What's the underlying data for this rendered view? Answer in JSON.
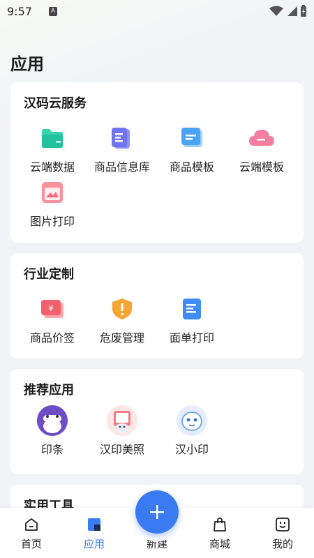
{
  "status_bar": {
    "time": "9:57",
    "badge": "A"
  },
  "page_title": "应用",
  "sections": {
    "cloud": {
      "title": "汉码云服务",
      "items": [
        "云端数据",
        "商品信息库",
        "商品模板",
        "云端模板",
        "图片打印"
      ]
    },
    "industry": {
      "title": "行业定制",
      "items": [
        "商品价签",
        "危废管理",
        "面单打印"
      ]
    },
    "recommended": {
      "title": "推荐应用",
      "items": [
        "印条",
        "汉印美照",
        "汉小印"
      ]
    },
    "tools": {
      "title": "实用工具"
    }
  },
  "bottom_nav": {
    "home": "首页",
    "apps": "应用",
    "create": "新建",
    "mall": "商城",
    "mine": "我的"
  },
  "colors": {
    "accent": "#3b7bf2",
    "background": "#f2f3f6"
  }
}
